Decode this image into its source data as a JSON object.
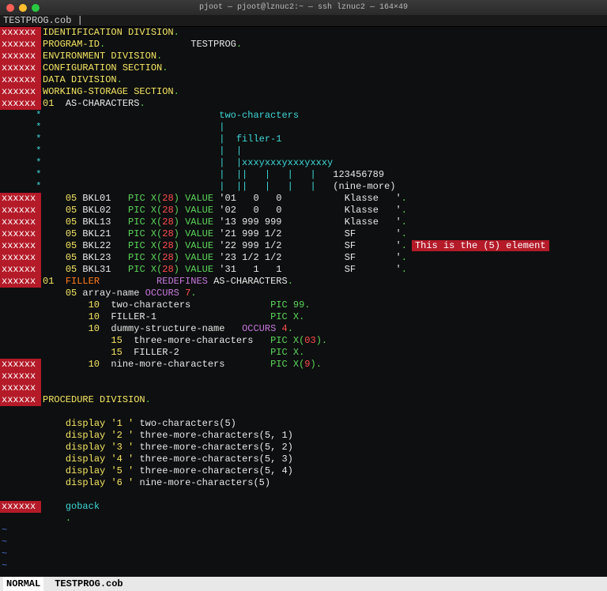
{
  "window": {
    "title": "pjoot — pjoot@lznuc2:~ — ssh lznuc2 — 164×49"
  },
  "tab": {
    "label": "TESTPROG.cob |"
  },
  "gutter": {
    "xxxx": "xxxxxx",
    "star": "*",
    "blank": ""
  },
  "src": {
    "l1": {
      "a": "IDENTIFICATION DIVISION",
      "b": "."
    },
    "l2": {
      "a": "PROGRAM-ID",
      "b": ".",
      "c": "TESTPROG",
      "d": "."
    },
    "l3": {
      "a": "ENVIRONMENT DIVISION",
      "b": "."
    },
    "l4": {
      "a": "CONFIGURATION SECTION",
      "b": "."
    },
    "l5": {
      "a": "DATA DIVISION",
      "b": "."
    },
    "l6": {
      "a": "WORKING-STORAGE SECTION",
      "b": "."
    },
    "l7": {
      "a": "01",
      "b": "AS-CHARACTERS",
      "c": "."
    },
    "c1": "                               two-characters",
    "c2": "                               |",
    "c3": "                               |  filler-1",
    "c4": "                               |  |",
    "c5": "                               |  |xxxyxxxyxxxyxxxy",
    "c6": {
      "a": "                               |  ||   |   |   |   ",
      "b": "123456789"
    },
    "c7": {
      "a": "                               |  ||   |   |   |   ",
      "b": "(nine-more)"
    },
    "bkl": [
      {
        "lvl": "05",
        "name": "BKL01",
        "pic": "PIC X",
        "n": "28",
        "val": "VALUE",
        "lit": "'01   0   0           Klasse   '",
        "dot": "."
      },
      {
        "lvl": "05",
        "name": "BKL02",
        "pic": "PIC X",
        "n": "28",
        "val": "VALUE",
        "lit": "'02   0   0           Klasse   '",
        "dot": "."
      },
      {
        "lvl": "05",
        "name": "BKL13",
        "pic": "PIC X",
        "n": "28",
        "val": "VALUE",
        "lit": "'13 999 999           Klasse   '",
        "dot": "."
      },
      {
        "lvl": "05",
        "name": "BKL21",
        "pic": "PIC X",
        "n": "28",
        "val": "VALUE",
        "lit": "'21 999 1/2           SF       '",
        "dot": "."
      },
      {
        "lvl": "05",
        "name": "BKL22",
        "pic": "PIC X",
        "n": "28",
        "val": "VALUE",
        "lit": "'22 999 1/2           SF       '",
        "dot": ".",
        "note": "This is the (5) element"
      },
      {
        "lvl": "05",
        "name": "BKL23",
        "pic": "PIC X",
        "n": "28",
        "val": "VALUE",
        "lit": "'23 1/2 1/2           SF       '",
        "dot": "."
      },
      {
        "lvl": "05",
        "name": "BKL31",
        "pic": "PIC X",
        "n": "28",
        "val": "VALUE",
        "lit": "'31   1   1           SF       '",
        "dot": "."
      }
    ],
    "l15": {
      "a": "01",
      "b": "FILLER",
      "c": "REDEFINES",
      "d": "AS-CHARACTERS",
      "e": "."
    },
    "l16": {
      "a": "05",
      "b": "array-name",
      "c": "OCCURS",
      "d": "7",
      "e": "."
    },
    "l17": {
      "a": "10",
      "b": "two-characters",
      "c": "PIC 99",
      "d": "."
    },
    "l18": {
      "a": "10",
      "b": "FILLER-1",
      "c": "PIC X",
      "d": "."
    },
    "l19": {
      "a": "10",
      "b": "dummy-structure-name",
      "c": "OCCURS",
      "d": "4",
      "e": "."
    },
    "l20": {
      "a": "15",
      "b": "three-more-characters",
      "c": "PIC X",
      "n": "03",
      "d": "."
    },
    "l21": {
      "a": "15",
      "b": "FILLER-2",
      "c": "PIC X",
      "d": "."
    },
    "l22": {
      "a": "10",
      "b": "nine-more-characters",
      "c": "PIC X",
      "n": "9",
      "d": "."
    },
    "l24": {
      "a": "PROCEDURE DIVISION",
      "b": "."
    },
    "disp": [
      {
        "kw": "display",
        "lit": "'1 '",
        "expr": "two-characters(5)"
      },
      {
        "kw": "display",
        "lit": "'2 '",
        "expr": "three-more-characters(5, 1)"
      },
      {
        "kw": "display",
        "lit": "'3 '",
        "expr": "three-more-characters(5, 2)"
      },
      {
        "kw": "display",
        "lit": "'4 '",
        "expr": "three-more-characters(5, 3)"
      },
      {
        "kw": "display",
        "lit": "'5 '",
        "expr": "three-more-characters(5, 4)"
      },
      {
        "kw": "display",
        "lit": "'6 '",
        "expr": "nine-more-characters(5)"
      }
    ],
    "goback": "goback",
    "dot": "."
  },
  "status": {
    "mode": "NORMAL",
    "file": "TESTPROG.cob"
  },
  "tilde": "~"
}
